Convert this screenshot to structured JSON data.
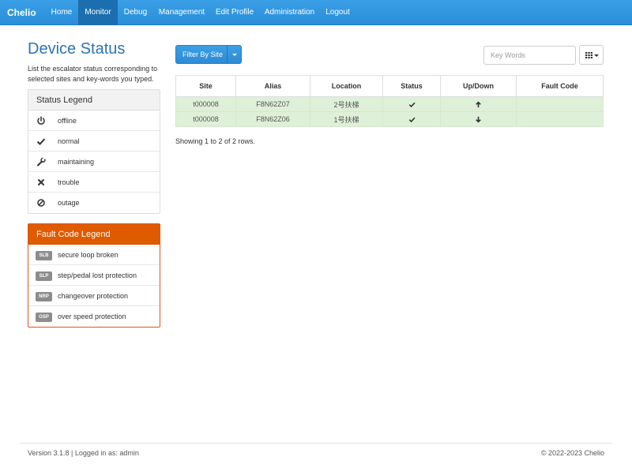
{
  "nav": {
    "brand": "Chelio",
    "items": [
      "Home",
      "Monitor",
      "Debug",
      "Management",
      "Edit Profile",
      "Administration",
      "Logout"
    ],
    "active": "Monitor"
  },
  "page": {
    "title": "Device Status",
    "description": "List the escalator status corresponding to selected sites and key-words you typed."
  },
  "status_legend": {
    "title": "Status Legend",
    "items": [
      {
        "icon": "power-icon",
        "label": "offline"
      },
      {
        "icon": "check-icon",
        "label": "normal"
      },
      {
        "icon": "wrench-icon",
        "label": "maintaining"
      },
      {
        "icon": "x-icon",
        "label": "trouble"
      },
      {
        "icon": "ban-icon",
        "label": "outage"
      }
    ]
  },
  "fault_legend": {
    "title": "Fault Code Legend",
    "items": [
      {
        "code": "SLB",
        "label": "secure loop broken"
      },
      {
        "code": "SLP",
        "label": "step/pedal lost protection"
      },
      {
        "code": "NRP",
        "label": "changeover protection"
      },
      {
        "code": "OSP",
        "label": "over speed protection"
      }
    ]
  },
  "toolbar": {
    "filter_label": "Filter By Site",
    "search_placeholder": "Key Words"
  },
  "table": {
    "columns": [
      "Site",
      "Alias",
      "Location",
      "Status",
      "Up/Down",
      "Fault Code"
    ],
    "rows": [
      {
        "site": "t000008",
        "alias": "F8N62Z07",
        "location": "2号扶梯",
        "status": "check-icon",
        "direction": "arrow-up-icon",
        "fault_code": ""
      },
      {
        "site": "t000008",
        "alias": "F8N62Z06",
        "location": "1号扶梯",
        "status": "check-icon",
        "direction": "arrow-down-icon",
        "fault_code": ""
      }
    ],
    "summary": "Showing 1 to 2 of 2 rows."
  },
  "footer": {
    "left": "Version 3.1.8 | Logged in as: admin",
    "right": "© 2022-2023  Chelio"
  },
  "colors": {
    "nav_bg": "#2a8ed9",
    "nav_active": "#1b6fae",
    "title": "#2e73b3",
    "fault_header": "#e05a00",
    "row_success": "#dff0d8",
    "badge": "#8c8c8c"
  }
}
